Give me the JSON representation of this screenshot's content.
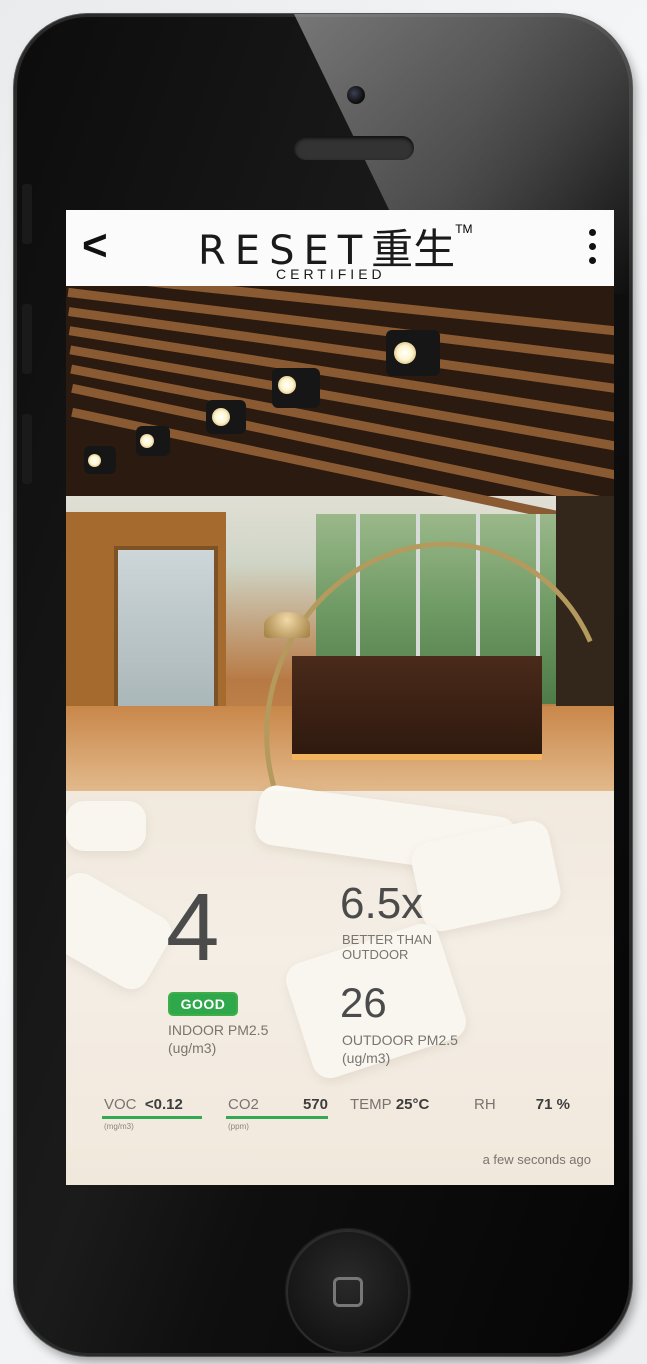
{
  "app": {
    "brand": "RESET",
    "brand_cn": "重生",
    "brand_tm": "TM",
    "brand_sub": "CERTIFIED"
  },
  "topbar": {
    "back_glyph": "<",
    "menu_icon": "vertical-dots-icon"
  },
  "stats": {
    "indoor_pm25_value": "4",
    "status_badge": "GOOD",
    "indoor_label_line1": "INDOOR PM2.5",
    "indoor_label_line2": "(ug/m3)",
    "ratio_value": "6.5x",
    "ratio_label_line1": "BETTER THAN",
    "ratio_label_line2": "OUTDOOR",
    "outdoor_pm25_value": "26",
    "outdoor_label_line1": "OUTDOOR PM2.5",
    "outdoor_label_line2": "(ug/m3)"
  },
  "metrics": {
    "voc_label": "VOC",
    "voc_value": "<0.12",
    "voc_unit": "(mg/m3)",
    "co2_label": "CO2",
    "co2_value": "570",
    "co2_unit": "(ppm)",
    "temp_label": "TEMP",
    "temp_value": "25°C",
    "rh_label": "RH",
    "rh_value": "71 %"
  },
  "updated": "a few seconds ago",
  "colors": {
    "good_green": "#2ea84b",
    "text_gray": "#7a7470",
    "number_gray": "#4b4b4b"
  }
}
